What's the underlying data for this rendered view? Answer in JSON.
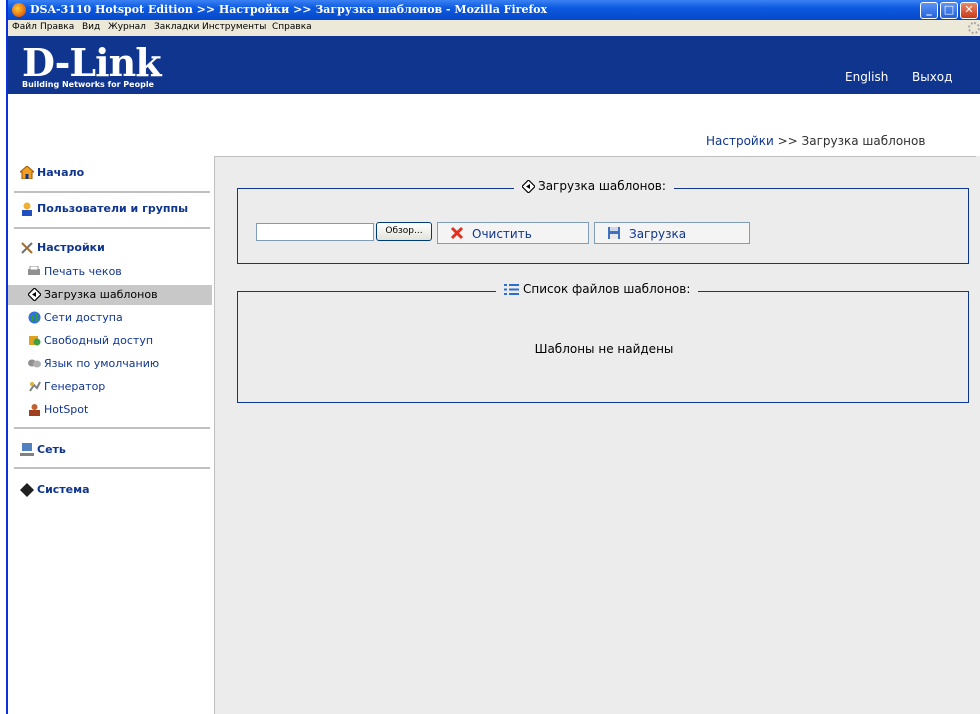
{
  "window": {
    "title": "DSA-3110 Hotspot Edition >> Настройки >> Загрузка шаблонов - Mozilla Firefox"
  },
  "menubar": {
    "items": [
      "Файл",
      "Правка",
      "Вид",
      "Журнал",
      "Закладки",
      "Инструменты",
      "Справка"
    ]
  },
  "header": {
    "logo": "D-Link",
    "tagline": "Building Networks for People",
    "english_link": "English",
    "exit_link": "Выход"
  },
  "breadcrumb": {
    "parent": "Настройки",
    "separator": ">>",
    "current": "Загрузка шаблонов"
  },
  "sidebar": {
    "home": "Начало",
    "users": "Пользователи и группы",
    "settings": "Настройки",
    "settings_items": [
      {
        "label": "Печать чеков",
        "icon": "printer-icon"
      },
      {
        "label": "Загрузка шаблонов",
        "icon": "diamond-arrow-icon"
      },
      {
        "label": "Сети доступа",
        "icon": "globe-icon"
      },
      {
        "label": "Свободный доступ",
        "icon": "free-access-icon"
      },
      {
        "label": "Язык по умолчанию",
        "icon": "language-icon"
      },
      {
        "label": "Генератор",
        "icon": "generator-icon"
      },
      {
        "label": "HotSpot",
        "icon": "hotspot-icon"
      }
    ],
    "network": "Сеть",
    "system": "Система"
  },
  "upload": {
    "legend": "Загрузка шаблонов:",
    "browse_label": "Обзор...",
    "clear_label": "Очистить",
    "upload_label": "Загрузка",
    "file_value": ""
  },
  "templates": {
    "legend": "Список файлов шаблонов:",
    "empty_message": "Шаблоны не найдены"
  },
  "colors": {
    "brand": "#10358f",
    "content_bg": "#ececec",
    "active_item": "#c8c8c8"
  }
}
